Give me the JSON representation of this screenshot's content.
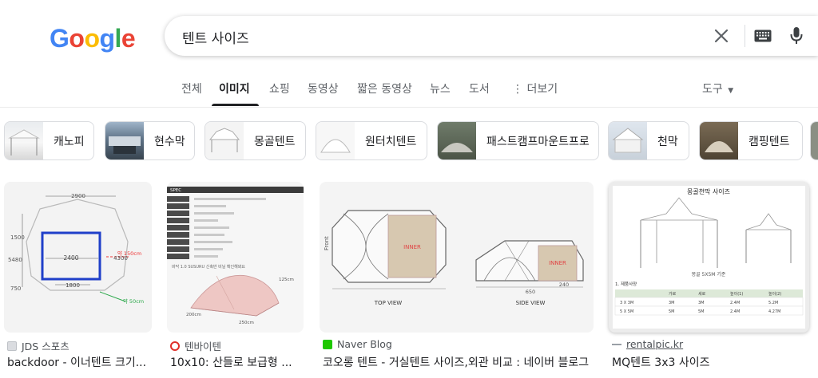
{
  "logo": {
    "letters": [
      "G",
      "o",
      "o",
      "g",
      "l",
      "e"
    ],
    "colors": [
      "#4285F4",
      "#EA4335",
      "#FBBC05",
      "#4285F4",
      "#34A853",
      "#EA4335"
    ]
  },
  "search": {
    "query": "텐트 사이즈"
  },
  "tabs": [
    {
      "label": "전체"
    },
    {
      "label": "이미지"
    },
    {
      "label": "쇼핑"
    },
    {
      "label": "동영상"
    },
    {
      "label": "짧은 동영상"
    },
    {
      "label": "뉴스"
    },
    {
      "label": "도서"
    },
    {
      "label": "더보기"
    }
  ],
  "active_tab": "이미지",
  "tools": {
    "label": "도구"
  },
  "chips": [
    {
      "label": "캐노피"
    },
    {
      "label": "현수막"
    },
    {
      "label": "몽골텐트"
    },
    {
      "label": "원터치텐트"
    },
    {
      "label": "패스트캠프마운트프로"
    },
    {
      "label": "천막"
    },
    {
      "label": "캠핑텐트"
    }
  ],
  "results": [
    {
      "source": "JDS 스포츠",
      "title": "backdoor - 이너텐트 크기...",
      "image_text": {
        "top": "2900",
        "left": "5480",
        "mid": "2400",
        "bottom": "1800",
        "right": "4300",
        "red": "약 150cm",
        "green": "약 50cm",
        "side": "1500",
        "side2": "750"
      }
    },
    {
      "source": "텐바이텐",
      "title": "10x10: 산들로 보급형 ...",
      "image_text": {
        "spec": "SPEC",
        "note": "바닥 1.0 SUSURU 신축반 비닐 확인해봐요",
        "dims": [
          "125cm",
          "200cm",
          "250cm"
        ]
      }
    },
    {
      "source": "Naver Blog",
      "title": "코오롱 텐트 - 거실텐트 사이즈,외관 비교 : 네이버 블로그",
      "image_text": {
        "top_view": "TOP VIEW",
        "side_view": "SIDE VIEW",
        "inner": "INNER",
        "front": "Front",
        "d1": "650",
        "d2": "240"
      }
    },
    {
      "source": "rentalpic.kr",
      "title": "MQ텐트 3x3 사이즈",
      "image_text": {
        "heading": "몽골천막 사이즈",
        "caption": "몽골 5X5M 기준",
        "table_title": "1. 제품사양",
        "cols": [
          "",
          "가로",
          "세로",
          "높이(1)",
          "높이(2)"
        ],
        "rows": [
          [
            "3 X 3M",
            "3M",
            "3M",
            "2.4M",
            "5.2M"
          ],
          [
            "5 X 5M",
            "5M",
            "5M",
            "2.4M",
            "4.27M"
          ]
        ]
      }
    }
  ]
}
